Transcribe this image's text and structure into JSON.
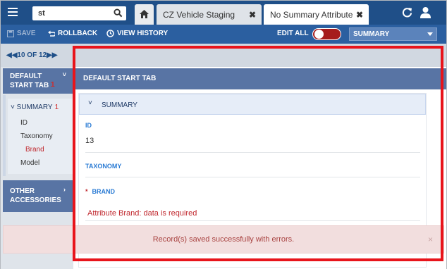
{
  "topbar": {
    "search_value": "st",
    "tabs": [
      {
        "label": "CZ Vehicle Staging",
        "close": "✖"
      },
      {
        "label": "No Summary Attribute",
        "close": "✖"
      }
    ]
  },
  "toolbar": {
    "save_label": "SAVE",
    "rollback_label": "ROLLBACK",
    "history_label": "VIEW HISTORY",
    "edit_all_label": "EDIT ALL",
    "view_select_value": "SUMMARY"
  },
  "sidebar": {
    "pager": "10 OF 12",
    "default_tab": {
      "label": "DEFAULT START TAB",
      "count": "1"
    },
    "summary": {
      "label": "SUMMARY",
      "count": "1"
    },
    "items": [
      {
        "label": "ID"
      },
      {
        "label": "Taxonomy"
      },
      {
        "label": "Brand"
      },
      {
        "label": "Model"
      }
    ],
    "other": {
      "label": "OTHER ACCESSORIES"
    }
  },
  "main": {
    "section_title": "DEFAULT START TAB",
    "card_title": "SUMMARY",
    "fields": {
      "id_label": "ID",
      "id_value": "13",
      "taxonomy_label": "TAXONOMY",
      "brand_required": "*",
      "brand_label": "BRAND",
      "brand_error": "Attribute Brand: data is required"
    }
  },
  "toast": {
    "message": "Record(s) saved successfully with errors.",
    "close": "×"
  },
  "colors": {
    "topbar": "#1f4f88",
    "toolbar": "#2b5fa0",
    "section_header": "#5874a4",
    "error": "#c0272d",
    "highlight": "#e8141b",
    "toast_bg": "#f2dede"
  }
}
